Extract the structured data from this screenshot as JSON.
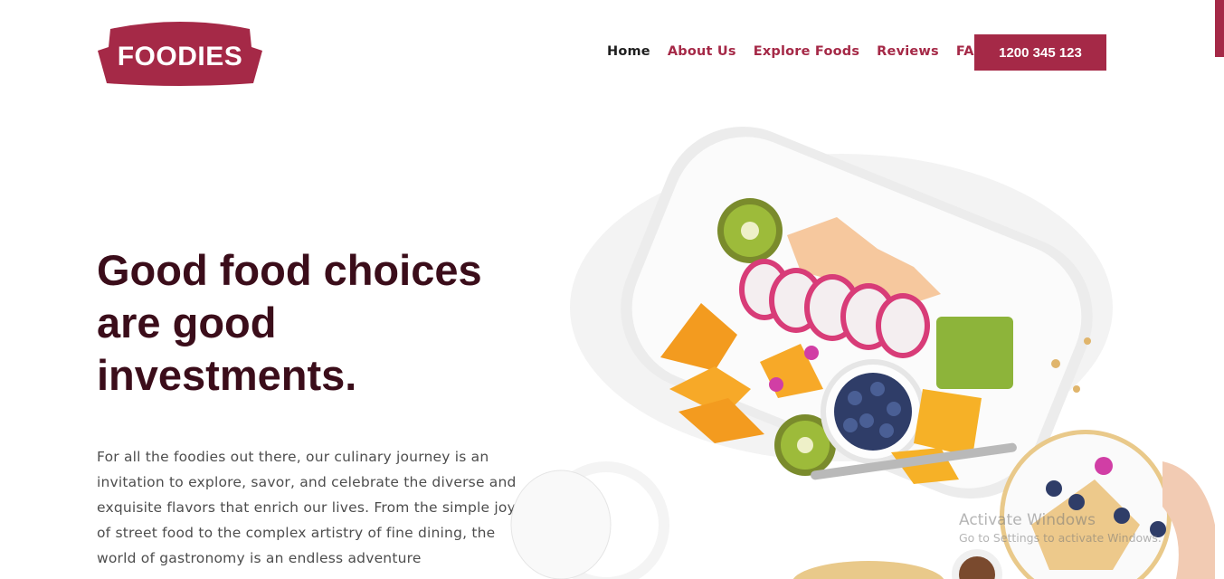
{
  "brand": {
    "name": "FOODIES",
    "color": "#a52947"
  },
  "nav": {
    "items": [
      {
        "label": "Home",
        "active": true
      },
      {
        "label": "About Us",
        "active": false
      },
      {
        "label": "Explore Foods",
        "active": false
      },
      {
        "label": "Reviews",
        "active": false
      },
      {
        "label": "FAQ",
        "active": false
      }
    ],
    "phone": "1200 345 123"
  },
  "hero": {
    "headline_lines": [
      "Good food choices",
      "are good",
      "investments."
    ],
    "intro": "For all the foodies out there, our culinary journey is an invitation to explore, savor, and celebrate the diverse and exquisite flavors that enrich our lives. From the simple joy of street food to the complex artistry of fine dining, the world of gastronomy is an endless adventure"
  },
  "illustration": {
    "icon": "fruit-platter-photo"
  },
  "overlay": {
    "line1": "Activate Windows",
    "line2": "Go to Settings to activate Windows."
  }
}
